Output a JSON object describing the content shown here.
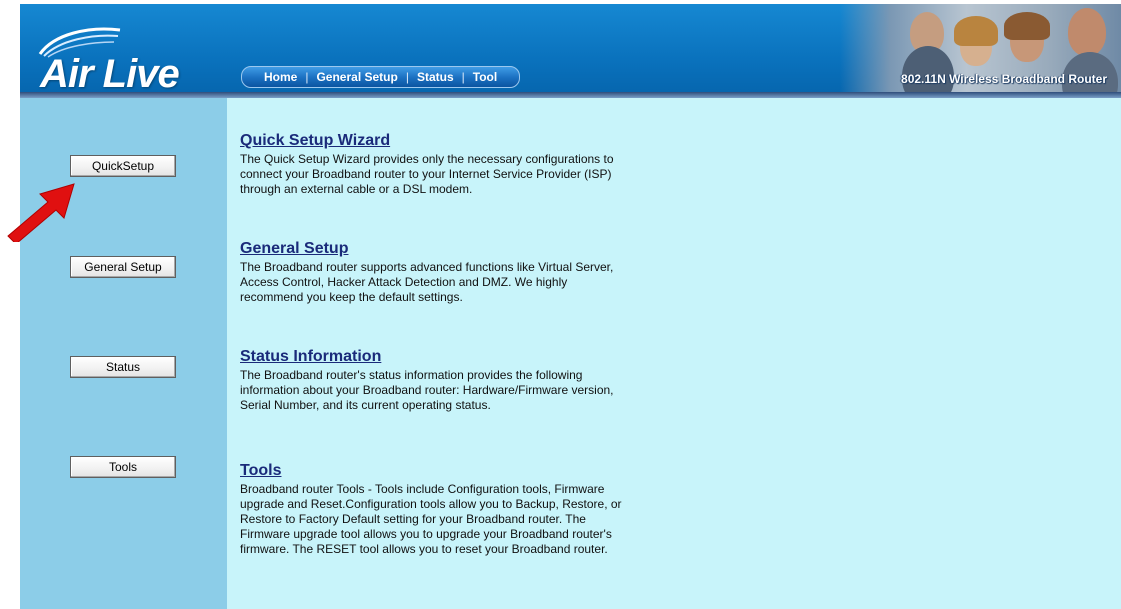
{
  "header": {
    "logo_text": "Air Live",
    "nav": [
      "Home",
      "General Setup",
      "Status",
      "Tool"
    ],
    "banner_caption": "802.11N Wireless Broadband Router"
  },
  "sidebar": {
    "buttons": [
      "QuickSetup",
      "General Setup",
      "Status",
      "Tools"
    ]
  },
  "content": {
    "sections": [
      {
        "title": "Quick Setup Wizard",
        "lines": [
          "The Quick Setup Wizard provides only the necessary configurations to",
          "connect your Broadband router to your Internet Service Provider (ISP)",
          "through an external cable or a DSL modem."
        ]
      },
      {
        "title": "General Setup",
        "lines": [
          "The Broadband router supports advanced functions like Virtual Server,",
          "Access Control, Hacker Attack Detection and DMZ. We highly",
          "recommend you keep the default settings."
        ]
      },
      {
        "title": "Status Information",
        "lines": [
          "The Broadband router's status information provides the following",
          "information about your Broadband router: Hardware/Firmware version,",
          "Serial Number, and its current operating status."
        ]
      },
      {
        "title": "Tools",
        "lines": [
          "Broadband router Tools - Tools include Configuration tools, Firmware",
          "upgrade and Reset.Configuration tools allow you to Backup, Restore, or",
          "Restore to Factory Default setting for your Broadband router. The",
          "Firmware upgrade tool allows you to upgrade your Broadband router's",
          "firmware. The RESET tool allows you to reset your Broadband router."
        ]
      }
    ]
  },
  "colors": {
    "header_blue": "#0a72bd",
    "sidebar": "#8ccde8",
    "content_bg": "#c8f4fa",
    "heading": "#1a2a7a",
    "arrow": "#e01010"
  },
  "icons": {
    "arrow": "red-arrow-icon",
    "logo": "airlive-logo"
  }
}
